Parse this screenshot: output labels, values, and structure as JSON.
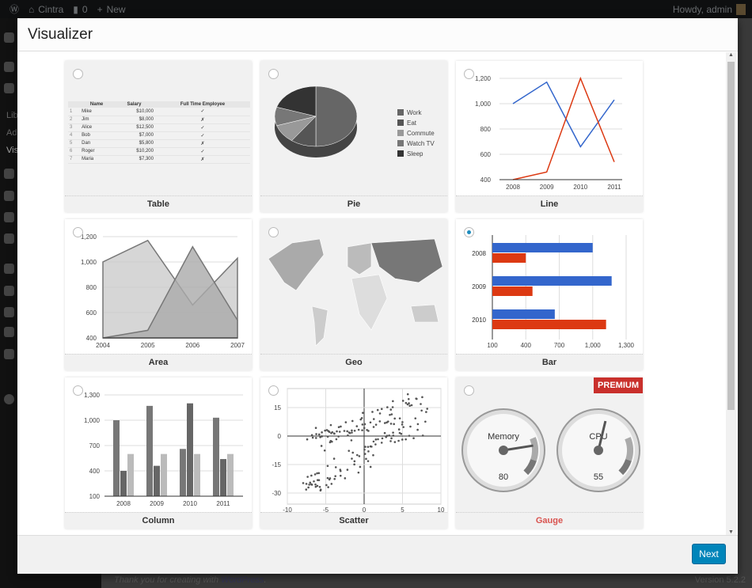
{
  "adminbar": {
    "site": "Cintra",
    "comments": "0",
    "new": "New",
    "howdy": "Howdy, admin"
  },
  "sidebar": {
    "items": [
      "Lib",
      "Ad",
      "Vis"
    ]
  },
  "modal": {
    "title": "Visualizer",
    "next": "Next"
  },
  "footer": {
    "thanks": "Thank you for creating with ",
    "wp_link": "WordPress",
    "period": ".",
    "version": "Version 5.2.2"
  },
  "colors": {
    "blue": "#3366cc",
    "red": "#dc3912",
    "primary": "#0085ba",
    "premium": "#c9302c"
  },
  "cards": [
    {
      "name": "Table",
      "selected": false
    },
    {
      "name": "Pie",
      "selected": false
    },
    {
      "name": "Line",
      "selected": false
    },
    {
      "name": "Area",
      "selected": false
    },
    {
      "name": "Geo",
      "selected": false
    },
    {
      "name": "Bar",
      "selected": true
    },
    {
      "name": "Column",
      "selected": false
    },
    {
      "name": "Scatter",
      "selected": false
    },
    {
      "name": "Gauge",
      "selected": false,
      "premium": true,
      "badge": "PREMIUM"
    }
  ],
  "table": {
    "headers": [
      "",
      "Name",
      "Salary",
      "Full Time Employee"
    ],
    "rows": [
      [
        "1",
        "Mike",
        "$10,000",
        "✓"
      ],
      [
        "2",
        "Jim",
        "$8,000",
        "✗"
      ],
      [
        "3",
        "Alice",
        "$12,500",
        "✓"
      ],
      [
        "4",
        "Bob",
        "$7,000",
        "✓"
      ],
      [
        "5",
        "Dan",
        "$5,800",
        "✗"
      ],
      [
        "6",
        "Roger",
        "$10,200",
        "✓"
      ],
      [
        "7",
        "Maria",
        "$7,300",
        "✗"
      ]
    ]
  },
  "chart_data": [
    {
      "type": "pie",
      "legend": [
        "Work",
        "Eat",
        "Commute",
        "Watch TV",
        "Sleep"
      ]
    },
    {
      "type": "line",
      "categories": [
        "2008",
        "2009",
        "2010",
        "2011"
      ],
      "yticks": [
        "400",
        "600",
        "800",
        "1,000",
        "1,200"
      ],
      "ylim": [
        400,
        1200
      ],
      "series": [
        {
          "values": [
            1000,
            1170,
            660,
            1030
          ]
        },
        {
          "values": [
            400,
            460,
            1200,
            540
          ]
        }
      ]
    },
    {
      "type": "area",
      "categories": [
        "2004",
        "2005",
        "2006",
        "2007"
      ],
      "yticks": [
        "400",
        "600",
        "800",
        "1,000",
        "1,200"
      ],
      "ylim": [
        400,
        1200
      ],
      "series": [
        {
          "values": [
            1000,
            1170,
            660,
            1030
          ]
        },
        {
          "values": [
            400,
            460,
            1120,
            540
          ]
        }
      ]
    },
    {
      "type": "bar",
      "categories": [
        "2008",
        "2009",
        "2010"
      ],
      "xticks": [
        "100",
        "400",
        "700",
        "1,000",
        "1,300"
      ],
      "xlim": [
        100,
        1300
      ],
      "series": [
        {
          "values": [
            1000,
            1170,
            660
          ]
        },
        {
          "values": [
            400,
            460,
            1120
          ]
        }
      ]
    },
    {
      "type": "column",
      "categories": [
        "2008",
        "2009",
        "2010",
        "2011"
      ],
      "yticks": [
        "100",
        "400",
        "700",
        "1,000",
        "1,300"
      ],
      "ylim": [
        100,
        1300
      ],
      "series": [
        {
          "values": [
            1000,
            1170,
            660,
            1030
          ]
        },
        {
          "values": [
            400,
            460,
            1200,
            540
          ]
        },
        {
          "values": [
            600,
            600,
            600,
            600
          ]
        }
      ]
    },
    {
      "type": "scatter",
      "xticks": [
        "-10",
        "-5",
        "0",
        "5",
        "10"
      ],
      "yticks": [
        "15",
        "0",
        "-15",
        "-30"
      ]
    },
    {
      "type": "gauge",
      "gauges": [
        {
          "label": "Memory",
          "value": 80
        },
        {
          "label": "CPU",
          "value": 55
        }
      ]
    }
  ]
}
